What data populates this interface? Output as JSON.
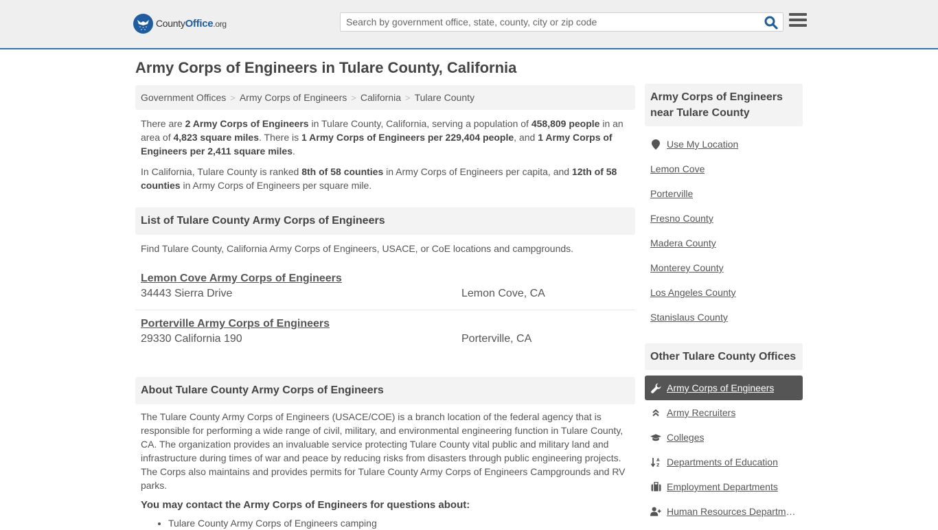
{
  "header": {
    "logo": {
      "name_part1": "County",
      "name_part2": "Office",
      "name_suffix": ".org"
    },
    "search": {
      "placeholder": "Search by government office, state, county, city or zip code",
      "value": ""
    },
    "colors": {
      "brand": "#1f5d9e",
      "header_border": "#2f76b0",
      "header_bg": "#efefef"
    }
  },
  "page": {
    "title": "Army Corps of Engineers in Tulare County, California"
  },
  "breadcrumb": [
    {
      "label": "Government Offices"
    },
    {
      "label": "Army Corps of Engineers"
    },
    {
      "label": "California"
    },
    {
      "label": "Tulare County"
    }
  ],
  "intro": {
    "p1": {
      "t1": "There are ",
      "b1": "2 Army Corps of Engineers",
      "t2": " in Tulare County, California, serving a population of ",
      "b2": "458,809 people",
      "t3": " in an area of ",
      "b3": "4,823 square miles",
      "t4": ". There is ",
      "b4": "1 Army Corps of Engineers per 229,404 people",
      "t5": ", and ",
      "b5": "1 Army Corps of Engineers per 2,411 square miles",
      "t6": "."
    },
    "p2": {
      "t1": "In California, Tulare County is ranked ",
      "b1": "8th of 58 counties",
      "t2": " in Army Corps of Engineers per capita, and ",
      "b2": "12th of 58 counties",
      "t3": " in Army Corps of Engineers per square mile."
    }
  },
  "list_section": {
    "heading": "List of Tulare County Army Corps of Engineers",
    "description": "Find Tulare County, California Army Corps of Engineers, USACE, or CoE locations and campgrounds.",
    "listings": [
      {
        "name": "Lemon Cove Army Corps of Engineers",
        "address": "34443 Sierra Drive",
        "city": "Lemon Cove, CA"
      },
      {
        "name": "Porterville Army Corps of Engineers",
        "address": "29330 California 190",
        "city": "Porterville, CA"
      }
    ]
  },
  "about_section": {
    "heading": "About Tulare County Army Corps of Engineers",
    "text": "The Tulare County Army Corps of Engineers (USACE/COE) is a branch location of the federal agency that is responsible for performing a wide range of civil, military, and environmental engineering function in Tulare County, CA. The organization provides an invaluable service protecting Tulare County vital public and military land and infrastructure during times of war and peace by reducing risks from disasters through public engineering projects. The Corps also maintains and provides permits for Tulare County Army Corps of Engineers Campgrounds and RV parks.",
    "contact_heading": "You may contact the Army Corps of Engineers for questions about:",
    "contact_items": [
      "Tulare County Army Corps of Engineers camping"
    ]
  },
  "sidebar": {
    "near": {
      "heading": "Army Corps of Engineers near Tulare County",
      "use_location": {
        "label": "Use My Location",
        "icon": "map-marker-icon"
      },
      "items": [
        {
          "label": "Lemon Cove"
        },
        {
          "label": "Porterville"
        },
        {
          "label": "Fresno County"
        },
        {
          "label": "Madera County"
        },
        {
          "label": "Monterey County"
        },
        {
          "label": "Los Angeles County"
        },
        {
          "label": "Stanislaus County"
        }
      ]
    },
    "other": {
      "heading": "Other Tulare County Offices",
      "items": [
        {
          "label": "Army Corps of Engineers",
          "icon": "wrench-icon",
          "active": true
        },
        {
          "label": "Army Recruiters",
          "icon": "chevron-double-up-icon"
        },
        {
          "label": "Colleges",
          "icon": "graduation-cap-icon"
        },
        {
          "label": "Departments of Education",
          "icon": "sort-alpha-down-icon"
        },
        {
          "label": "Employment Departments",
          "icon": "briefcase-icon"
        },
        {
          "label": "Human Resources Departments",
          "icon": "user-plus-icon"
        }
      ],
      "active_bg": "#555555"
    }
  }
}
